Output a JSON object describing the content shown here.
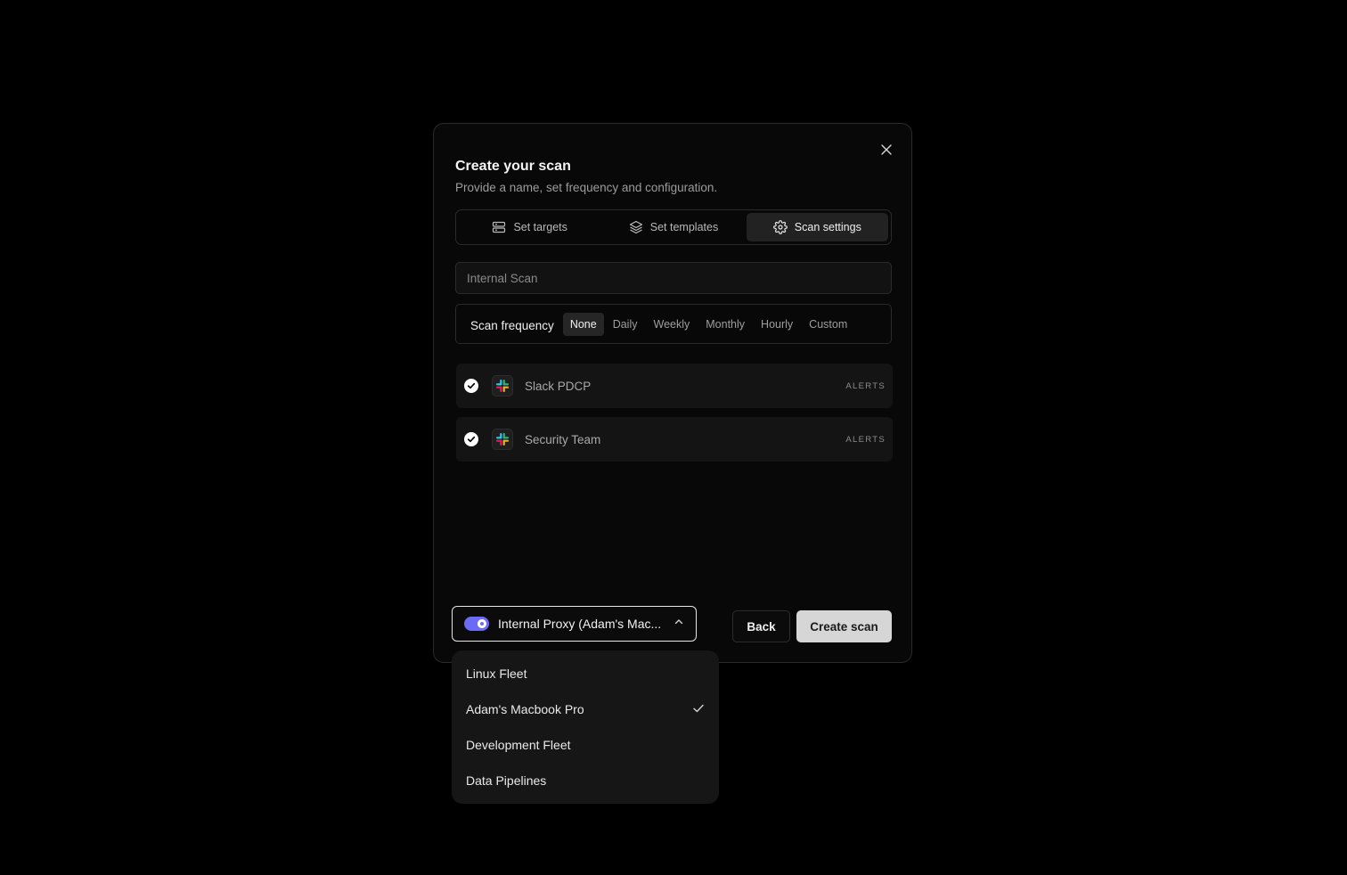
{
  "dialog": {
    "title": "Create your scan",
    "subtitle": "Provide a name, set frequency and configuration."
  },
  "tabs": [
    {
      "label": "Set targets",
      "icon": "server-icon",
      "active": false
    },
    {
      "label": "Set templates",
      "icon": "layers-icon",
      "active": false
    },
    {
      "label": "Scan settings",
      "icon": "gear-icon",
      "active": true
    }
  ],
  "scan_name": {
    "placeholder": "Internal Scan",
    "value": ""
  },
  "frequency": {
    "label": "Scan frequency",
    "options": [
      "None",
      "Daily",
      "Weekly",
      "Monthly",
      "Hourly",
      "Custom"
    ],
    "selected": "None"
  },
  "integrations": [
    {
      "name": "Slack PDCP",
      "tag": "ALERTS",
      "checked": true,
      "icon": "slack-icon"
    },
    {
      "name": "Security Team",
      "tag": "ALERTS",
      "checked": true,
      "icon": "slack-icon"
    }
  ],
  "proxy": {
    "label": "Internal Proxy (Adam's Mac...",
    "enabled": true,
    "toggle_color": "#6b6bf5"
  },
  "buttons": {
    "back": "Back",
    "create": "Create scan"
  },
  "dropdown": {
    "items": [
      "Linux Fleet",
      "Adam's Macbook Pro",
      "Development Fleet",
      "Data Pipelines"
    ],
    "selected": "Adam's Macbook Pro"
  }
}
